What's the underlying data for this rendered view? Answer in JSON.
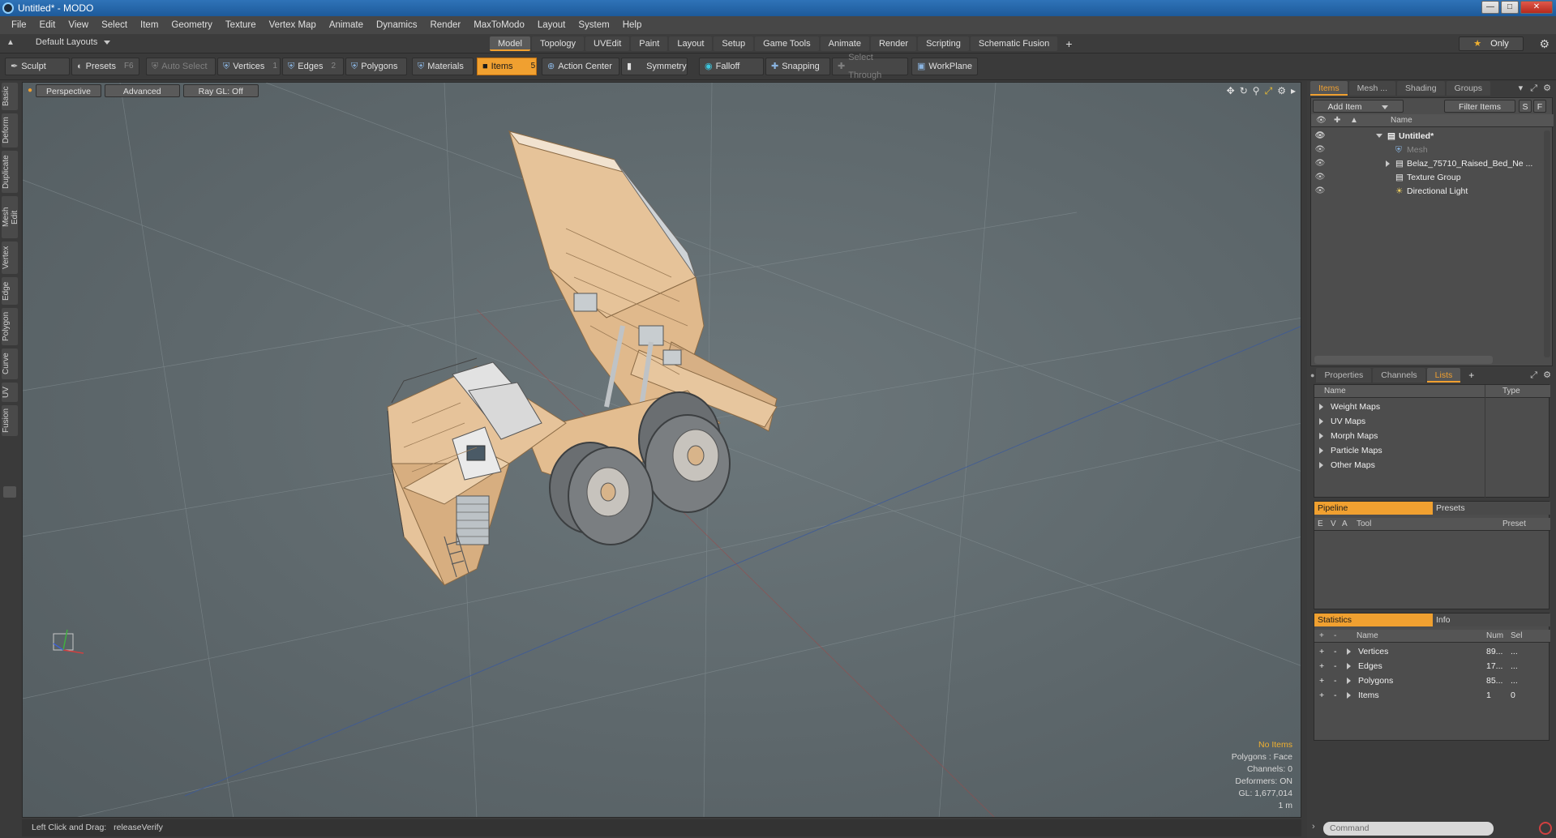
{
  "window": {
    "title": "Untitled* - MODO"
  },
  "menu": [
    "File",
    "Edit",
    "View",
    "Select",
    "Item",
    "Geometry",
    "Texture",
    "Vertex Map",
    "Animate",
    "Dynamics",
    "Render",
    "MaxToModo",
    "Layout",
    "System",
    "Help"
  ],
  "layout": {
    "selector": "Default Layouts",
    "tabs": [
      "Model",
      "Topology",
      "UVEdit",
      "Paint",
      "Layout",
      "Setup",
      "Game Tools",
      "Animate",
      "Render",
      "Scripting",
      "Schematic Fusion"
    ],
    "active_tab": "Model",
    "only_label": "Only"
  },
  "toolbar": {
    "sculpt": "Sculpt",
    "presets": "Presets",
    "presets_key": "F6",
    "auto_select": "Auto Select",
    "vertices": "Vertices",
    "vertices_key": "1",
    "edges": "Edges",
    "edges_key": "2",
    "polygons": "Polygons",
    "materials": "Materials",
    "items": "Items",
    "items_key": "5",
    "action_center": "Action Center",
    "symmetry": "Symmetry",
    "falloff": "Falloff",
    "snapping": "Snapping",
    "select_through": "Select Through",
    "workplane": "WorkPlane"
  },
  "left_tabs": [
    "Basic",
    "Deform",
    "Duplicate",
    "Mesh Edit",
    "Vertex",
    "Edge",
    "Polygon",
    "Curve",
    "UV",
    "Fusion"
  ],
  "viewport": {
    "view": "Perspective",
    "shading": "Advanced",
    "raygl": "Ray GL: Off",
    "info": {
      "no_items": "No Items",
      "polygons": "Polygons : Face",
      "channels": "Channels: 0",
      "deformers": "Deformers: ON",
      "gl": "GL: 1,677,014",
      "scale": "1 m"
    }
  },
  "status": {
    "label": "Left Click and Drag:",
    "value": "releaseVerify"
  },
  "items_panel": {
    "tabs": [
      "Items",
      "Mesh ...",
      "Shading",
      "Groups"
    ],
    "active_tab": "Items",
    "add_item": "Add Item",
    "filter": "Filter Items",
    "btn_s": "S",
    "btn_f": "F",
    "col_name": "Name",
    "tree": [
      {
        "label": "Untitled*",
        "bold": true,
        "dim": false
      },
      {
        "label": "Mesh",
        "bold": false,
        "dim": true
      },
      {
        "label": "Belaz_75710_Raised_Bed_Ne ...",
        "bold": false,
        "dim": false
      },
      {
        "label": "Texture Group",
        "bold": false,
        "dim": false
      },
      {
        "label": "Directional Light",
        "bold": false,
        "dim": false
      }
    ]
  },
  "lists_panel": {
    "tabs": [
      "Properties",
      "Channels",
      "Lists"
    ],
    "active_tab": "Lists",
    "col_name": "Name",
    "col_type": "Type",
    "rows": [
      "Weight Maps",
      "UV Maps",
      "Morph Maps",
      "Particle Maps",
      "Other Maps"
    ]
  },
  "pipeline_panel": {
    "tab_on": "Pipeline",
    "tab_off": "Presets",
    "cols": [
      "E",
      "V",
      "A",
      "Tool",
      "Preset"
    ]
  },
  "stats_panel": {
    "tab_on": "Statistics",
    "tab_off": "Info",
    "cols": [
      "Name",
      "Num",
      "Sel"
    ],
    "rows": [
      {
        "name": "Vertices",
        "num": "89...",
        "sel": "..."
      },
      {
        "name": "Edges",
        "num": "17...",
        "sel": "..."
      },
      {
        "name": "Polygons",
        "num": "85...",
        "sel": "..."
      },
      {
        "name": "Items",
        "num": "1",
        "sel": "0"
      }
    ]
  },
  "command": {
    "placeholder": "Command"
  },
  "colors": {
    "accent": "#f0a030",
    "viewport_bg": "#5e686c",
    "truck": "#e8c49a"
  }
}
